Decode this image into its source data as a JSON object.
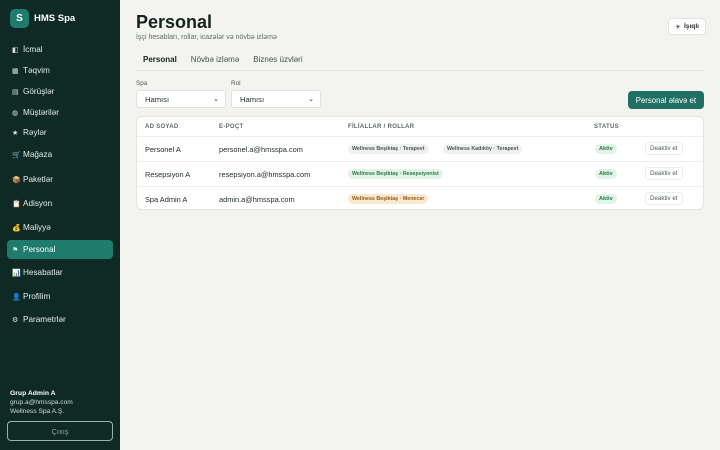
{
  "brand": {
    "logo_letter": "S",
    "name": "HMS Spa"
  },
  "nav": [
    {
      "icon": "◧",
      "icon_name": "overview-icon",
      "label": "İcmal"
    },
    {
      "icon": "▦",
      "icon_name": "calendar-icon",
      "label": "Təqvim"
    },
    {
      "icon": "▤",
      "icon_name": "appointments-icon",
      "label": "Görüşlər"
    },
    {
      "icon": "◍",
      "icon_name": "clients-icon",
      "label": "Müştərilər"
    },
    {
      "icon": "★",
      "icon_name": "reviews-icon",
      "label": "Rəylər"
    },
    {
      "icon": "🛒",
      "icon_name": "store-icon",
      "label": "Mağaza"
    },
    {
      "icon": "📦",
      "icon_name": "packages-icon",
      "label": "Paketlər"
    },
    {
      "icon": "📋",
      "icon_name": "tabs-icon",
      "label": "Adisyon"
    },
    {
      "icon": "💰",
      "icon_name": "finance-icon",
      "label": "Maliyyə"
    },
    {
      "icon": "⚑",
      "icon_name": "staff-icon",
      "label": "Personal"
    },
    {
      "icon": "📊",
      "icon_name": "reports-icon",
      "label": "Hesabatlar"
    },
    {
      "icon": "👤",
      "icon_name": "profile-icon",
      "label": "Profilim"
    },
    {
      "icon": "⚙",
      "icon_name": "settings-icon",
      "label": "Parametrlər"
    }
  ],
  "active_nav": "Personal",
  "user": {
    "name": "Grup Admin A",
    "email": "grup.a@hmsspa.com",
    "company": "Wellness Spa A.Ş."
  },
  "logout_label": "Çıxış",
  "header": {
    "title": "Personal",
    "subtitle": "İşçi hesabları, rollar, icazələr və növbə izləmə",
    "lang_button": "İşıqlı",
    "lang_icon": "☀"
  },
  "tabs": [
    "Personal",
    "Növbə izləmə",
    "Biznes üzvləri"
  ],
  "active_tab": "Personal",
  "filters": {
    "spa": {
      "label": "Spa",
      "value": "Hamısı"
    },
    "rol": {
      "label": "Rol",
      "value": "Hamısı"
    }
  },
  "add_button": "Personal əlavə et",
  "table": {
    "columns": [
      "AD SOYAD",
      "E-POÇT",
      "FİLİALLAR / ROLLAR",
      "STATUS"
    ],
    "rows": [
      {
        "name": "Personel A",
        "email": "personel.a@hmsspa.com",
        "roles": [
          {
            "text": "Wellness Beşiktaş · Terapevt",
            "tone": "gray"
          },
          {
            "text": "Wellness Kadıköy · Terapevt",
            "tone": "gray"
          }
        ],
        "status": "Aktiv",
        "action": "Deaktiv et"
      },
      {
        "name": "Resepsiyon A",
        "email": "resepsiyon.a@hmsspa.com",
        "roles": [
          {
            "text": "Wellness Beşiktaş · Resepsiyonist",
            "tone": "green"
          }
        ],
        "status": "Aktiv",
        "action": "Deaktiv et"
      },
      {
        "name": "Spa Admin A",
        "email": "admin.a@hmsspa.com",
        "roles": [
          {
            "text": "Wellness Beşiktaş · Menecer",
            "tone": "amber"
          }
        ],
        "status": "Aktiv",
        "action": "Deaktiv et"
      }
    ]
  }
}
